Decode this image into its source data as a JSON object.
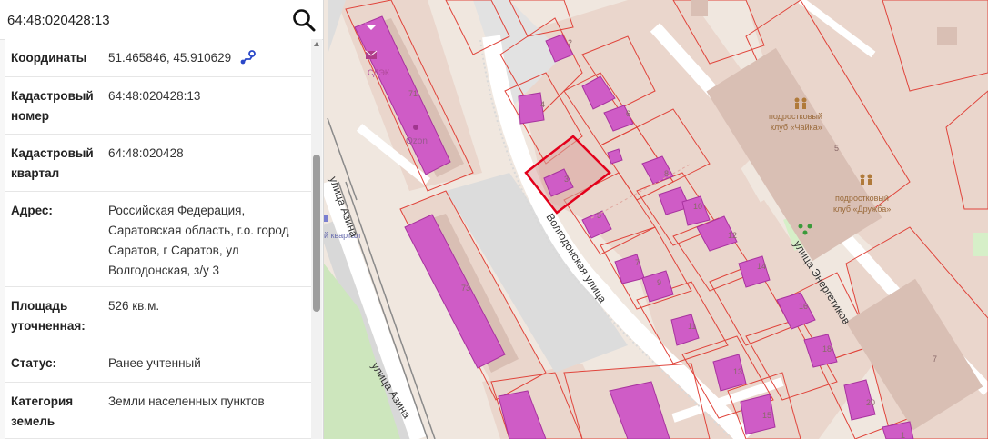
{
  "search": {
    "value": "64:48:020428:13"
  },
  "info_rows": [
    {
      "label": "Координаты",
      "value": "51.465846, 45.910629"
    },
    {
      "label": "Кадастровый номер",
      "value": "64:48:020428:13"
    },
    {
      "label": "Кадастровый квартал",
      "value": "64:48:020428"
    },
    {
      "label": "Адрес:",
      "value": "Российская Федерация, Саратовская область, г.о. город Саратов, г Саратов, ул Волгодонская, з/у 3"
    },
    {
      "label": "Площадь уточненная:",
      "value": "526 кв.м."
    },
    {
      "label": "Статус:",
      "value": "Ранее учтенный"
    },
    {
      "label": "Категория земель",
      "value": "Земли населенных пунктов"
    }
  ],
  "map": {
    "streets": {
      "volgodonskaya": "Волгодонская улица",
      "energetikov": "улица Энергетиков",
      "azina_1": "улица Азина",
      "azina_2": "улица Азина"
    },
    "pois": {
      "sdek": "СДЭК",
      "ozon": "Ozon",
      "club_chaika_1": "подростковый",
      "club_chaika_2": "клуб «Чайка»",
      "club_druzhba_1": "подростковый",
      "club_druzhba_2": "клуб «Дружба»",
      "station": "й квартал"
    },
    "house_numbers": [
      "71",
      "73",
      "2",
      "4",
      "6",
      "3",
      "8",
      "5",
      "10",
      "12",
      "7",
      "9",
      "14",
      "11",
      "16",
      "13",
      "18",
      "15",
      "20",
      "5",
      "7",
      "1"
    ],
    "colors": {
      "parcel_stroke": "#e0443b",
      "building_fill": "#cf5cc6",
      "selected_stroke": "#e3001b",
      "road": "#ffffff",
      "park": "#cde6bd",
      "residential": "#ecdbd2"
    }
  }
}
